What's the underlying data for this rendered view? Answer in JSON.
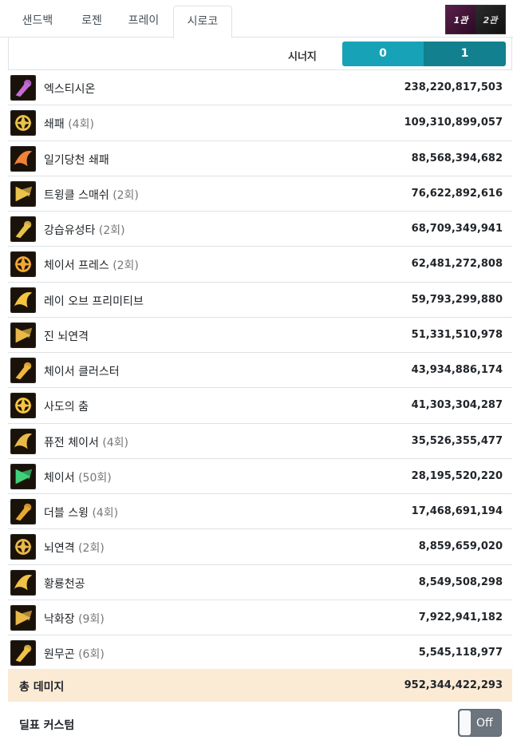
{
  "tabs": [
    {
      "label": "샌드백",
      "active": false
    },
    {
      "label": "로젠",
      "active": false
    },
    {
      "label": "프레이",
      "active": false
    },
    {
      "label": "시로코",
      "active": true
    }
  ],
  "phase_toggle": {
    "phase1": "1관",
    "phase2": "2관"
  },
  "synergy": {
    "label": "시너지",
    "options": [
      "0",
      "1"
    ],
    "selected": "1"
  },
  "skills": [
    {
      "name": "엑스티시온",
      "count": "",
      "value": "238,220,817,503",
      "icon": "spiral-burst-icon",
      "color": "#c46bd6"
    },
    {
      "name": "쇄패",
      "count": "(4회)",
      "value": "109,310,899,057",
      "icon": "club-icon",
      "color": "#e8c24a"
    },
    {
      "name": "일기당천 쇄패",
      "count": "",
      "value": "88,568,394,682",
      "icon": "fire-swirl-icon",
      "color": "#f0823a"
    },
    {
      "name": "트윙클 스매쉬",
      "count": "(2회)",
      "value": "76,622,892,616",
      "icon": "twinkle-club-icon",
      "color": "#e8c24a"
    },
    {
      "name": "강습유성타",
      "count": "(2회)",
      "value": "68,709,349,941",
      "icon": "meteor-strike-icon",
      "color": "#e8c24a"
    },
    {
      "name": "체이서 프레스",
      "count": "(2회)",
      "value": "62,481,272,808",
      "icon": "flame-press-icon",
      "color": "#f0a832"
    },
    {
      "name": "레이 오브 프리미티브",
      "count": "",
      "value": "59,793,299,880",
      "icon": "ray-burst-icon",
      "color": "#f5c542"
    },
    {
      "name": "진 뇌연격",
      "count": "",
      "value": "51,331,510,978",
      "icon": "target-orb-icon",
      "color": "#e8b84a"
    },
    {
      "name": "체이서 클러스터",
      "count": "",
      "value": "43,934,886,174",
      "icon": "cluster-icon",
      "color": "#f0b83a"
    },
    {
      "name": "사도의 춤",
      "count": "",
      "value": "41,303,304,287",
      "icon": "slash-dance-icon",
      "color": "#f5c542"
    },
    {
      "name": "퓨전 체이서",
      "count": "(4회)",
      "value": "35,526,355,477",
      "icon": "fusion-swirl-icon",
      "color": "#e8b84a"
    },
    {
      "name": "체이서",
      "count": "(50회)",
      "value": "28,195,520,220",
      "icon": "green-orb-icon",
      "color": "#3fd17a"
    },
    {
      "name": "더블 스윙",
      "count": "(4회)",
      "value": "17,468,691,194",
      "icon": "double-swing-icon",
      "color": "#e8a832"
    },
    {
      "name": "뇌연격",
      "count": "(2회)",
      "value": "8,859,659,020",
      "icon": "thunder-strike-icon",
      "color": "#e8b84a"
    },
    {
      "name": "황룡천공",
      "count": "",
      "value": "8,549,508,298",
      "icon": "dragon-swirl-icon",
      "color": "#f0c24a"
    },
    {
      "name": "낙화장",
      "count": "(9회)",
      "value": "7,922,941,182",
      "icon": "palm-strike-icon",
      "color": "#e8b84a"
    },
    {
      "name": "원무곤",
      "count": "(6회)",
      "value": "5,545,118,977",
      "icon": "spin-staff-icon",
      "color": "#f0c24a"
    }
  ],
  "total": {
    "label": "총 데미지",
    "value": "952,344,422,293"
  },
  "custom": {
    "label": "딜표 커스텀",
    "switch_text": "Off",
    "enabled": false
  }
}
